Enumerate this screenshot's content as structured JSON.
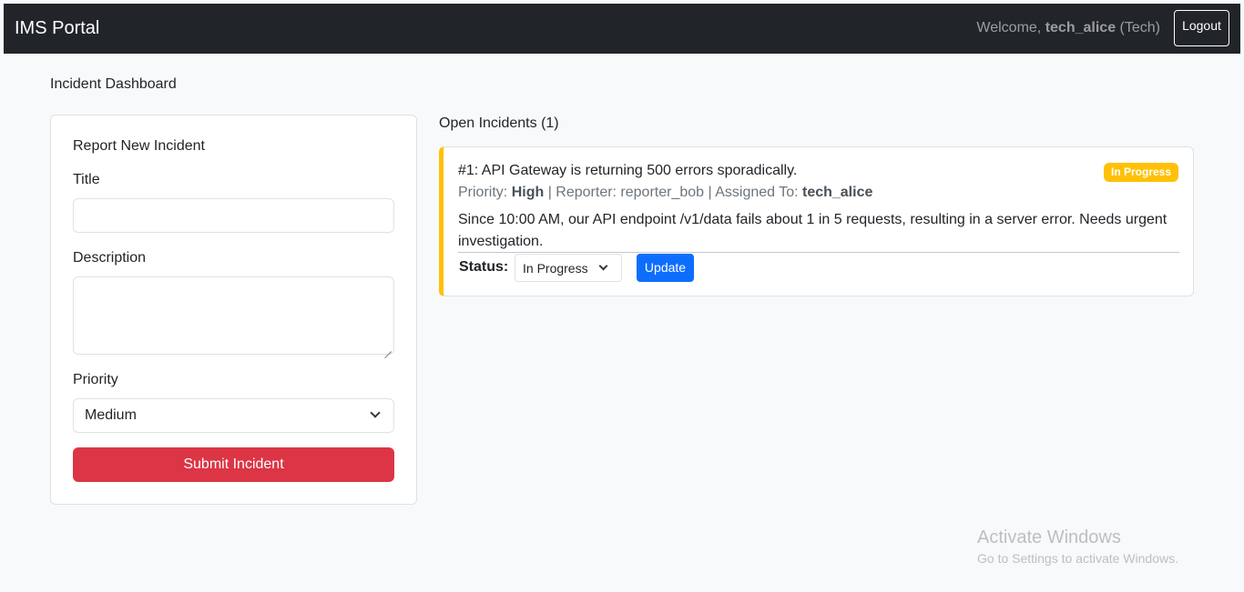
{
  "navbar": {
    "brand": "IMS Portal",
    "welcome_prefix": "Welcome,",
    "username": "tech_alice",
    "role": "(Tech)",
    "logout_label": "Logout"
  },
  "page": {
    "title": "Incident Dashboard"
  },
  "report_form": {
    "heading": "Report New Incident",
    "title_label": "Title",
    "title_value": "",
    "description_label": "Description",
    "description_value": "",
    "priority_label": "Priority",
    "priority_selected": "Medium",
    "submit_label": "Submit Incident"
  },
  "incidents": {
    "heading": "Open Incidents (1)",
    "items": [
      {
        "header": "#1: API Gateway is returning 500 errors sporadically.",
        "status_badge": "In Progress",
        "priority_label": "Priority:",
        "priority": "High",
        "reporter_text": "| Reporter: reporter_bob | Assigned To:",
        "assigned_to": "tech_alice",
        "description": "Since 10:00 AM, our API endpoint /v1/data fails about 1 in 5 requests, resulting in a server error. Needs urgent investigation.",
        "status_label": "Status:",
        "status_selected": "In Progress",
        "update_label": "Update"
      }
    ]
  },
  "overlay": {
    "activate_title": "Activate Windows",
    "activate_sub": "Go to Settings to activate Windows."
  },
  "colors": {
    "navbar": "#212529",
    "danger": "#dc3545",
    "primary": "#0d6efd",
    "warning": "#ffc107"
  }
}
